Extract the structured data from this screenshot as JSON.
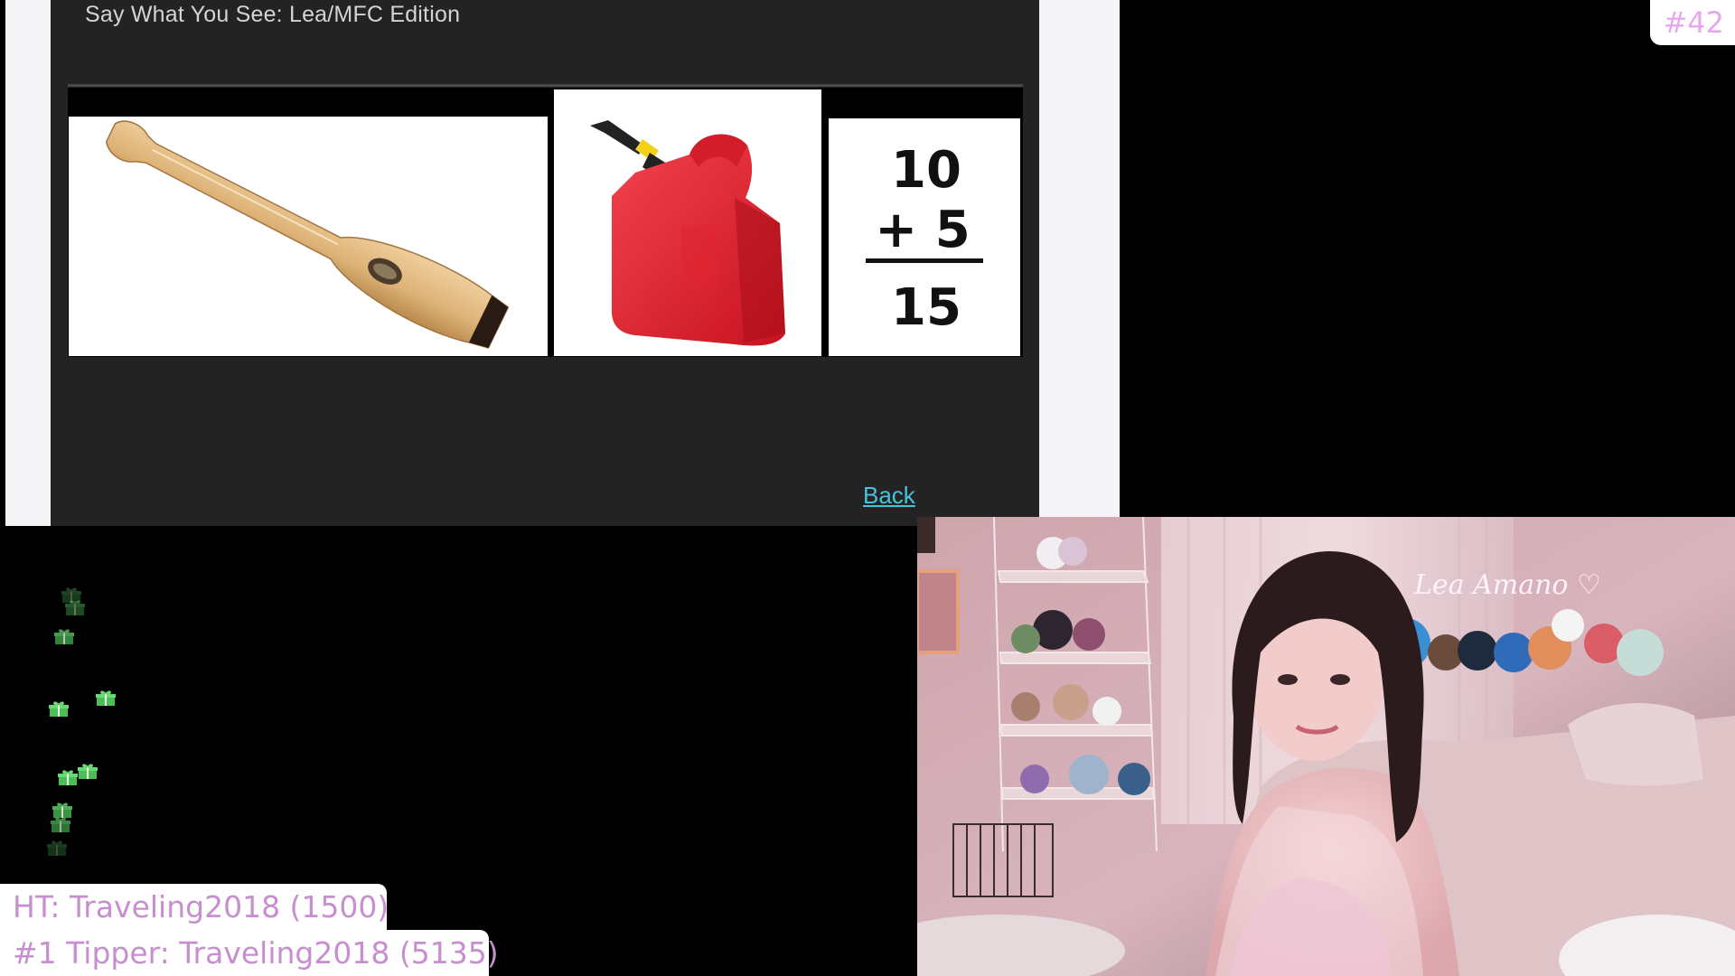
{
  "game": {
    "title": "Say What You See: Lea/MFC Edition",
    "back_label": "Back",
    "math": {
      "top": "10",
      "middle": "+ 5",
      "result": "15"
    },
    "images": [
      "paddle",
      "gas-can",
      "math-sum"
    ]
  },
  "overlay": {
    "counter": "#42",
    "high_tip": "HT: Traveling2018 (1500)",
    "top_tipper": "#1 Tipper: Traveling2018 (5135)",
    "signature": "Lea Amano",
    "gift_icon": "gift-icon"
  },
  "colors": {
    "accent_pink": "#e7a7ee",
    "link_blue": "#47c3e0",
    "gift_green": "#3fa44a"
  }
}
